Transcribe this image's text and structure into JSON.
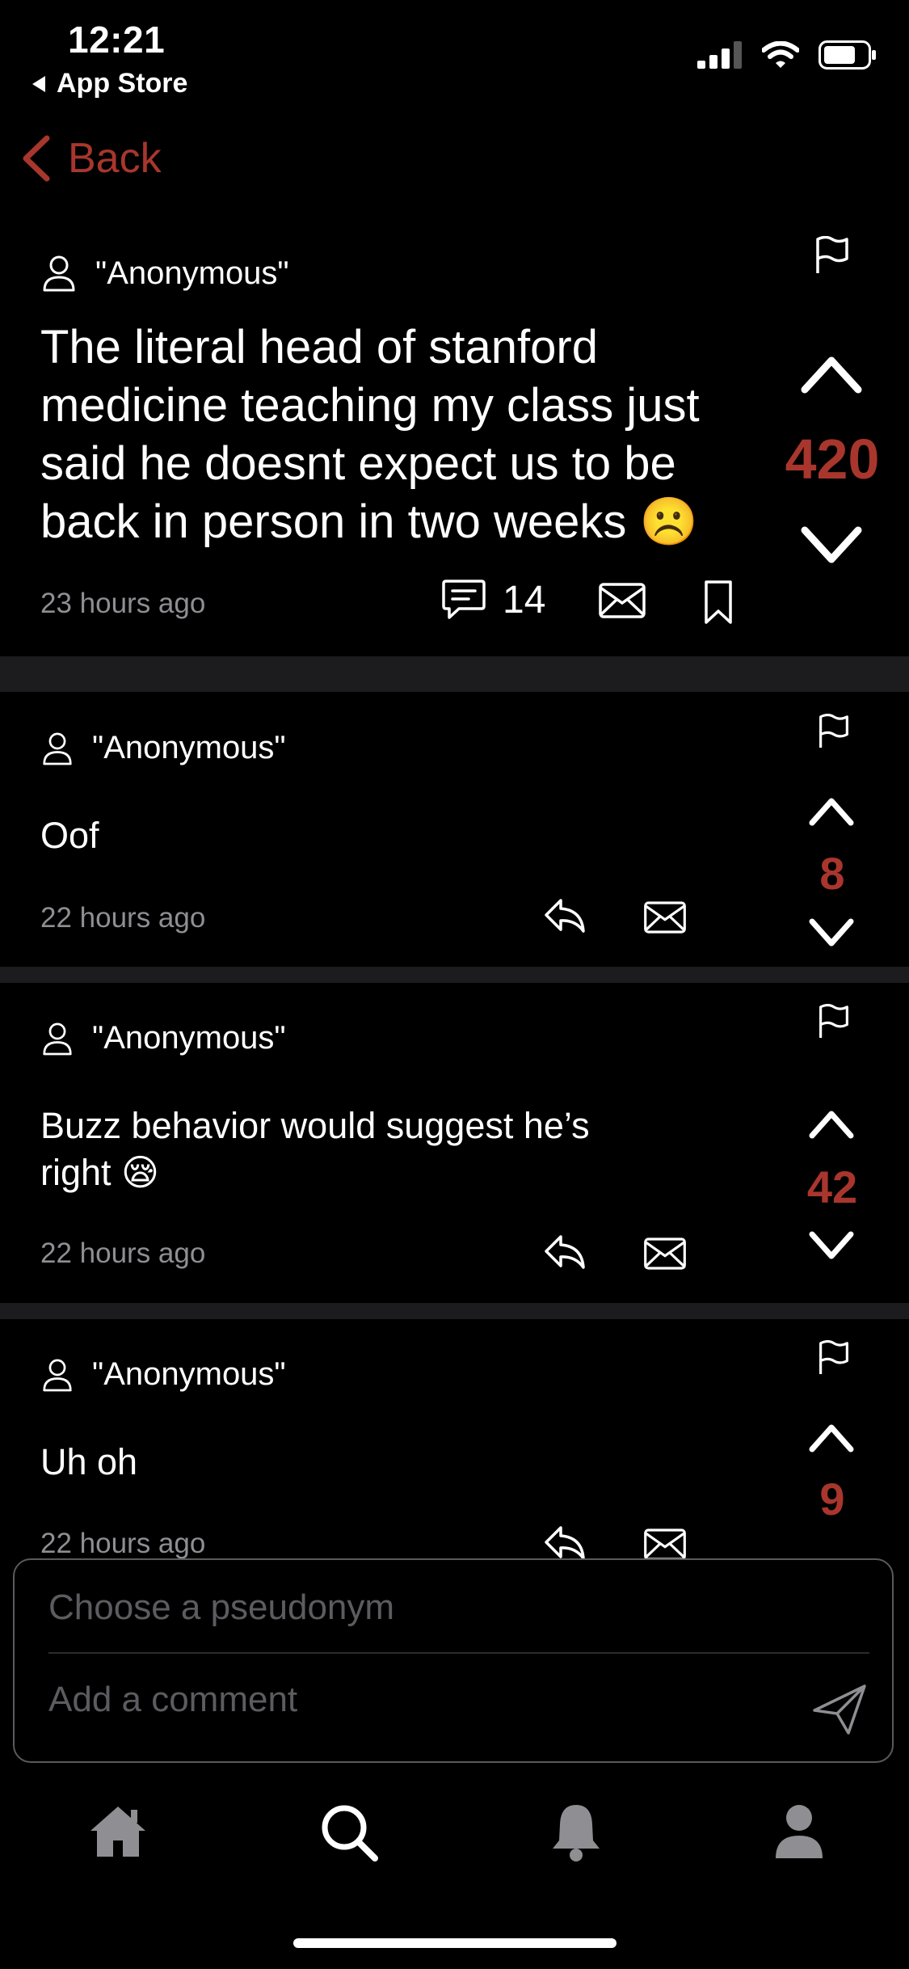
{
  "status_bar": {
    "time": "12:21",
    "back_app": "App Store"
  },
  "nav": {
    "back_label": "Back"
  },
  "post": {
    "author": "\"Anonymous\"",
    "body": "The literal head of stanford medicine teaching my class just said he doesnt expect us to be back in person in two weeks",
    "emoji": "☹️",
    "time": "23 hours ago",
    "comment_count": "14",
    "votes": "420"
  },
  "comments": [
    {
      "author": "\"Anonymous\"",
      "body": "Oof",
      "emoji": "",
      "time": "22 hours ago",
      "votes": "8"
    },
    {
      "author": "\"Anonymous\"",
      "body": "Buzz behavior would suggest he’s right",
      "emoji": "😪",
      "time": "22 hours ago",
      "votes": "42"
    },
    {
      "author": "\"Anonymous\"",
      "body": "Uh oh",
      "emoji": "",
      "time": "22 hours ago",
      "votes": "9"
    }
  ],
  "composer": {
    "pseudonym_placeholder": "Choose a pseudonym",
    "comment_placeholder": "Add a comment"
  },
  "tabs": [
    {
      "name": "home",
      "icon": "home-icon"
    },
    {
      "name": "search",
      "icon": "search-icon"
    },
    {
      "name": "notifications",
      "icon": "bell-icon"
    },
    {
      "name": "profile",
      "icon": "person-icon"
    }
  ],
  "colors": {
    "accent": "#a8362d",
    "background": "#000000",
    "separator": "#1c1c1e",
    "meta": "#8e8e93"
  }
}
